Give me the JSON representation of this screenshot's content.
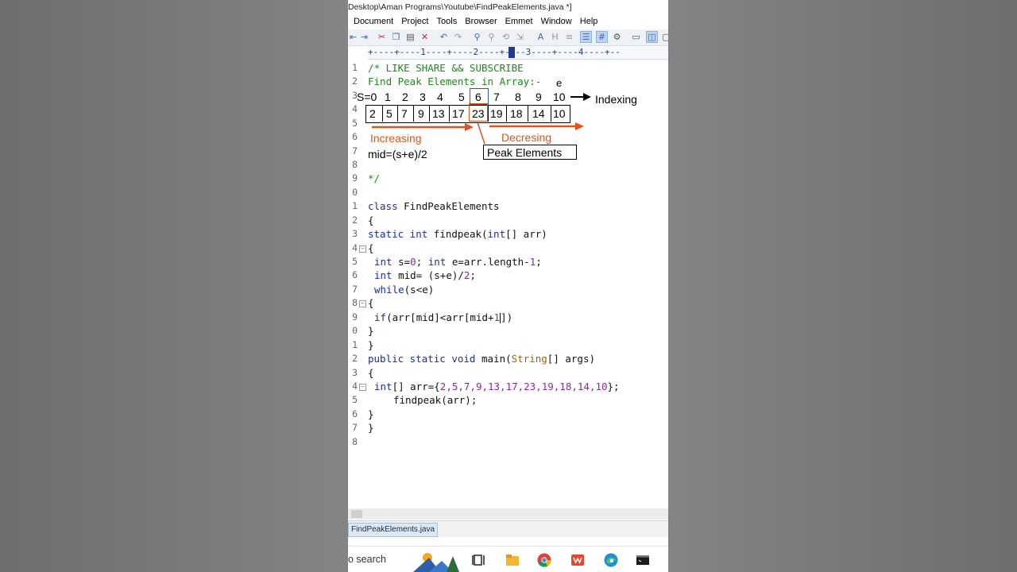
{
  "window": {
    "title": "Desktop\\Aman Programs\\Youtube\\FindPeakElements.java *]"
  },
  "menu": [
    {
      "label": "Document"
    },
    {
      "label": "Project"
    },
    {
      "label": "Tools"
    },
    {
      "label": "Browser"
    },
    {
      "label": "Emmet"
    },
    {
      "label": "Window"
    },
    {
      "label": "Help"
    }
  ],
  "ruler": {
    "text": "+----+----1----+----2----+----3----+----4----+--"
  },
  "line_numbers": [
    "1",
    "2",
    "3",
    "4",
    "5",
    "6",
    "7",
    "8",
    "9",
    "0",
    "1",
    "2",
    "3",
    "4",
    "5",
    "6",
    "7",
    "8",
    "9",
    "0",
    "1",
    "2",
    "3",
    "4",
    "5",
    "6",
    "7",
    "8"
  ],
  "code": {
    "l1": "/* LIKE SHARE && SUBSCRIBE",
    "l2": "Find Peak Elements in Array:-",
    "l9": "*/",
    "l11a": "class ",
    "l11b": "FindPeakElements",
    "l12": "{",
    "l13a": "static int ",
    "l13b": "findpeak(",
    "l13c": "int",
    "l13d": "[] arr)",
    "l14": "{",
    "l15a": "int ",
    "l15b": "s=",
    "l15c": "0",
    "l15d": "; ",
    "l15e": "int ",
    "l15f": "e=arr.length-",
    "l15g": "1",
    "l15h": ";",
    "l16a": "int ",
    "l16b": "mid= (s+e)/",
    "l16c": "2",
    "l16d": ";",
    "l17a": "while",
    "l17b": "(s<e)",
    "l18": "{",
    "l19a": "if",
    "l19b": "(arr[mid]<arr[mid+",
    "l19c": "1",
    "l19d": "])",
    "l20": "}",
    "l21": "}",
    "l22a": "public static void ",
    "l22b": "main(",
    "l22c": "String",
    "l22d": "[] args)",
    "l23": "{",
    "l24a": "int",
    "l24b": "[] arr={",
    "l24c": "2,5,7,9,13,17,23,19,18,14,10",
    "l24d": "};",
    "l25": "findpeak(arr);",
    "l26": "}",
    "l27": "}"
  },
  "annotation": {
    "e_label": "e",
    "s_label": "S=0",
    "indices": [
      "1",
      "2",
      "3",
      "4",
      "5",
      "6",
      "7",
      "8",
      "9",
      "10"
    ],
    "array": [
      "2",
      "5",
      "7",
      "9",
      "13",
      "17",
      "23",
      "19",
      "18",
      "14",
      "10"
    ],
    "indexing": "Indexing",
    "increasing": "Increasing",
    "decreasing": "Decresing",
    "peak": "Peak  Elements",
    "mid": "mid=(s+e)/2"
  },
  "tab": {
    "label": "FindPeakElements.java"
  },
  "taskbar": {
    "search": "o search"
  },
  "colors": {
    "comment": "#1a8a1a",
    "keyword": "#1c2ca8",
    "type": "#b35a00",
    "number": "#8a2aa0",
    "annotation": "#e0531a"
  }
}
